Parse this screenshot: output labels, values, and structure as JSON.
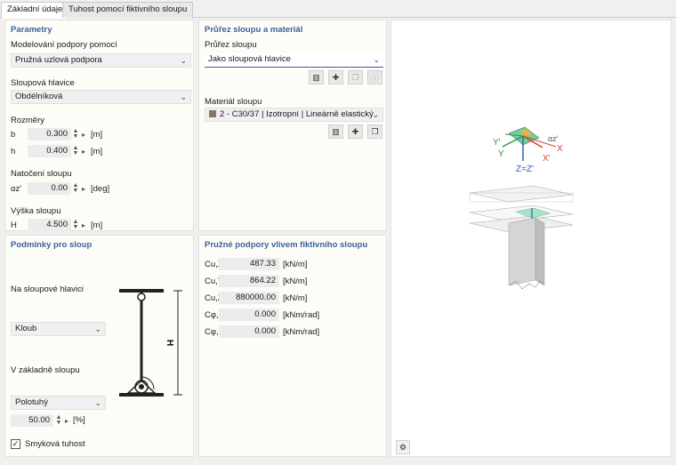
{
  "tabs": [
    {
      "label": "Základní údaje"
    },
    {
      "label": "Tuhost pomocí fiktivního sloupu"
    }
  ],
  "parametry": {
    "title": "Parametry",
    "modelovani_label": "Modelování podpory pomocí",
    "modelovani_value": "Pružná uzlová podpora",
    "hlavice_label": "Sloupová hlavice",
    "hlavice_value": "Obdélníková",
    "rozmery_label": "Rozměry",
    "b_label": "b",
    "b_value": "0.300",
    "b_unit": "[m]",
    "h_label": "h",
    "h_value": "0.400",
    "h_unit": "[m]",
    "natoceni_label": "Natočení sloupu",
    "alpha_label": "αz'",
    "alpha_value": "0.00",
    "alpha_unit": "[deg]",
    "vyska_label": "Výška sloupu",
    "H_label": "H",
    "H_value": "4.500",
    "H_unit": "[m]"
  },
  "prurez": {
    "title": "Průřez sloupu a materiál",
    "prurez_label": "Průřez sloupu",
    "prurez_value": "Jako sloupová hlavice",
    "material_label": "Materiál sloupu",
    "material_value": "2 - C30/37 | Izotropní | Lineárně elastický",
    "material_color": "#8a7560"
  },
  "podminky": {
    "title": "Podmínky pro sloup",
    "hlavice_label": "Na sloupové hlavici",
    "hlavice_value": "Kloub",
    "zaklad_label": "V základně sloupu",
    "zaklad_value": "Polotuhý",
    "percent_value": "50.00",
    "percent_unit": "[%]",
    "smykova_label": "Smyková tuhost",
    "smykova_checked": true,
    "diagram_H": "H"
  },
  "pruzne": {
    "title": "Pružné podpory vlivem fiktivního sloupu",
    "rows": [
      {
        "label": "Cu,X'",
        "value": "487.33",
        "unit": "[kN/m]"
      },
      {
        "label": "Cu,Y'",
        "value": "864.22",
        "unit": "[kN/m]"
      },
      {
        "label": "Cu,Z'",
        "value": "880000.00",
        "unit": "[kN/m]"
      },
      {
        "label": "Cφ,X'",
        "value": "0.000",
        "unit": "[kNm/rad]"
      },
      {
        "label": "Cφ,Y'",
        "value": "0.000",
        "unit": "[kNm/rad]"
      }
    ]
  },
  "preview": {
    "axis_y_prime": "Y'",
    "axis_y": "Y",
    "axis_x": "X",
    "axis_x_prime": "X'",
    "axis_alpha": "αz'",
    "axis_z": "Z=Z'"
  },
  "colors": {
    "accent": "#3b5fa0",
    "panel_bg": "#fdfdf7",
    "axis_green": "#2e9a4a",
    "axis_red": "#d9412b",
    "axis_blue": "#2f5fb8",
    "plate": "#6fcf9f"
  }
}
